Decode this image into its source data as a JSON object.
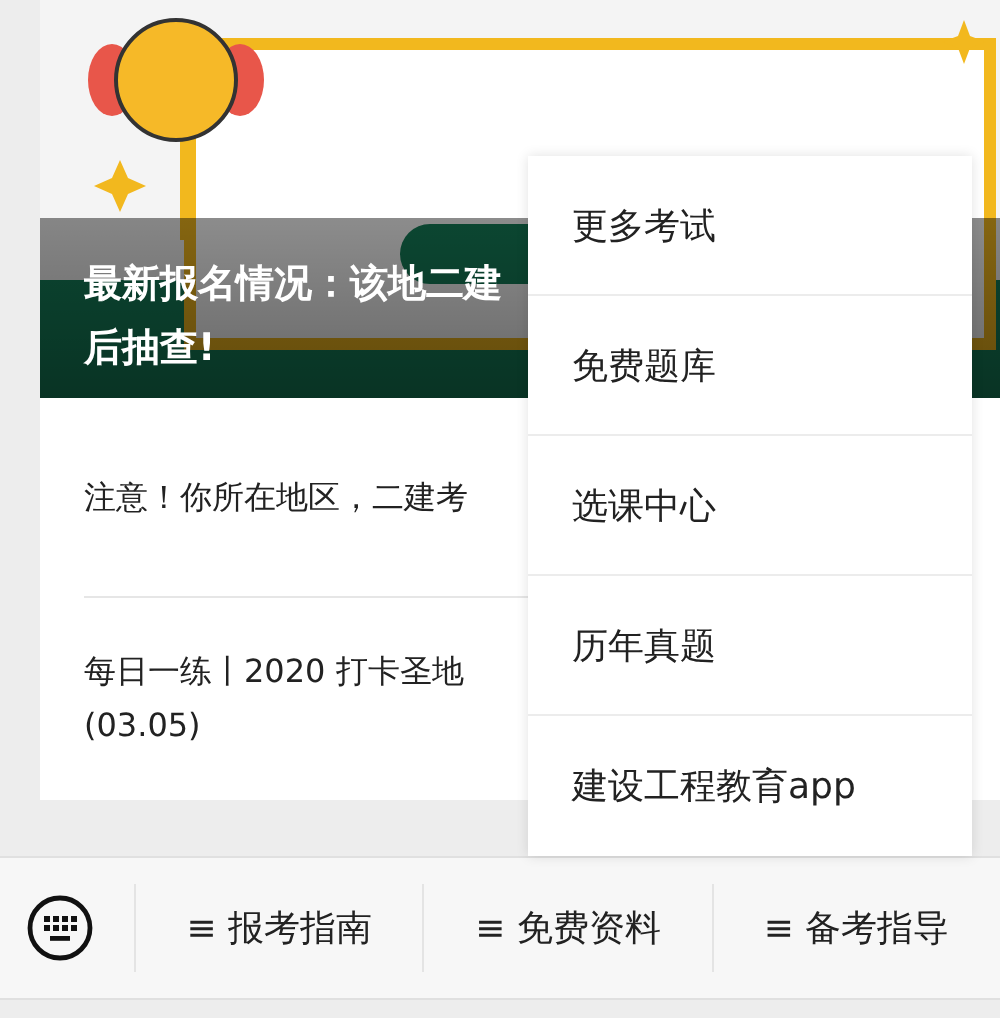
{
  "article_card": {
    "cover_title_lines": [
      "最新报名情况：该地二建",
      "后抽查!"
    ],
    "items": [
      {
        "lines": [
          "注意！你所在地区，二建考"
        ]
      },
      {
        "lines": [
          "每日一练丨2020 打卡圣地",
          "(03.05)"
        ]
      }
    ]
  },
  "popup_menu": {
    "items": [
      "更多考试",
      "免费题库",
      "选课中心",
      "历年真题",
      "建设工程教育app"
    ]
  },
  "bottom_menu": {
    "items": [
      "≡ 报考指南",
      "≡ 免费资料",
      "≡ 备考指导"
    ]
  }
}
